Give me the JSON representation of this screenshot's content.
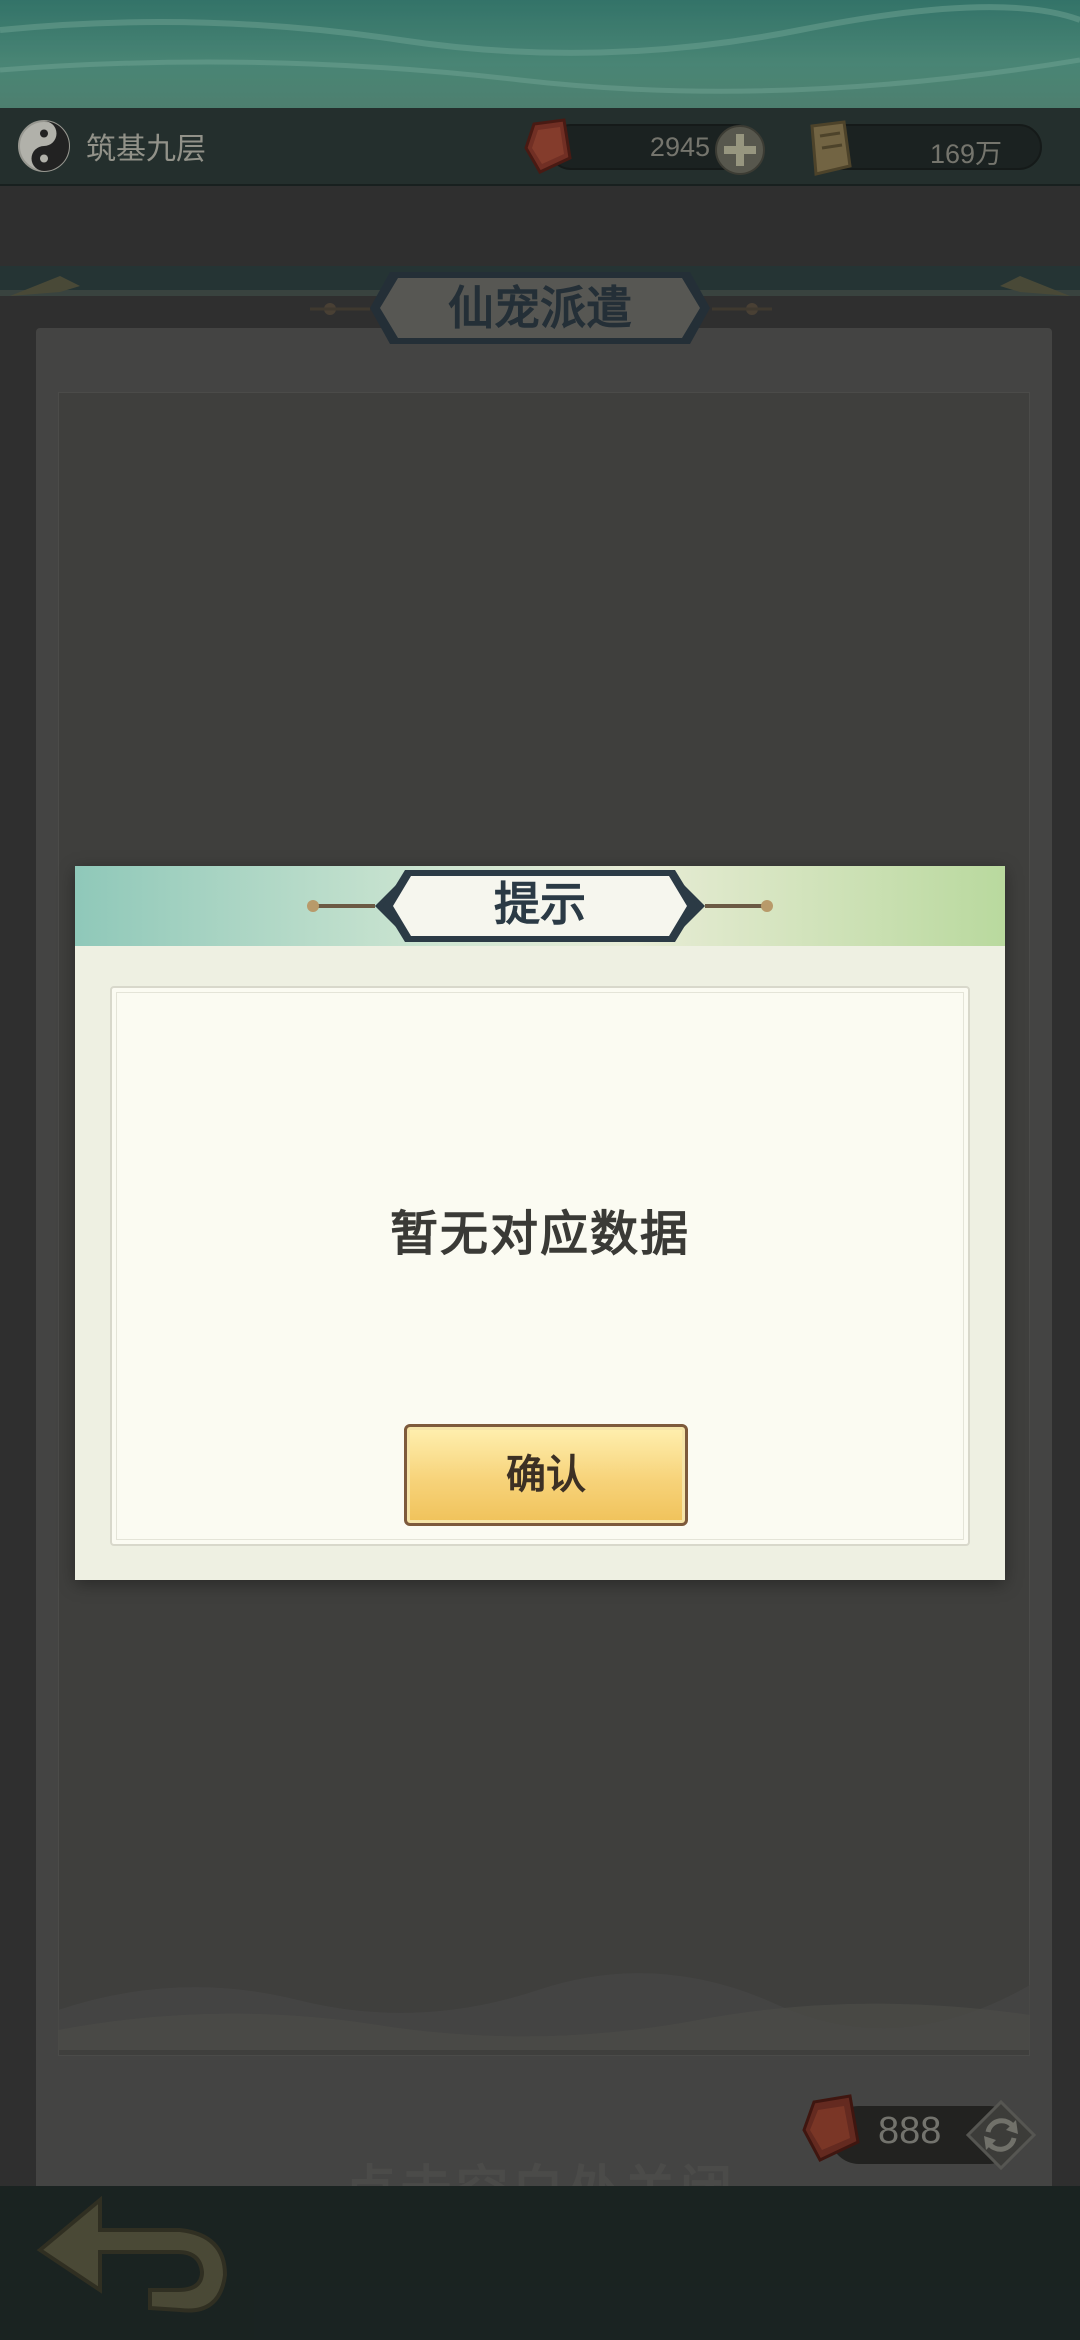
{
  "status_bar": {
    "realm_label": "筑基九层",
    "jade_amount": "2945",
    "ticket_amount": "169万"
  },
  "screen": {
    "title": "仙宠派遣"
  },
  "modal": {
    "title": "提示",
    "message": "暂无对应数据",
    "confirm_label": "确认"
  },
  "footer": {
    "cost_amount": "888",
    "close_hint": "点击空白处关闭"
  },
  "icons": {
    "realm": "taiji-icon",
    "jade": "red-jade-icon",
    "plus": "plus-icon",
    "ticket": "golden-ticket-icon",
    "refresh": "refresh-icon",
    "back": "back-arrow-icon"
  },
  "colors": {
    "accent_gold": "#f0c25a",
    "title_ink": "#2b3a45",
    "sky_green": "#5aa38f"
  }
}
